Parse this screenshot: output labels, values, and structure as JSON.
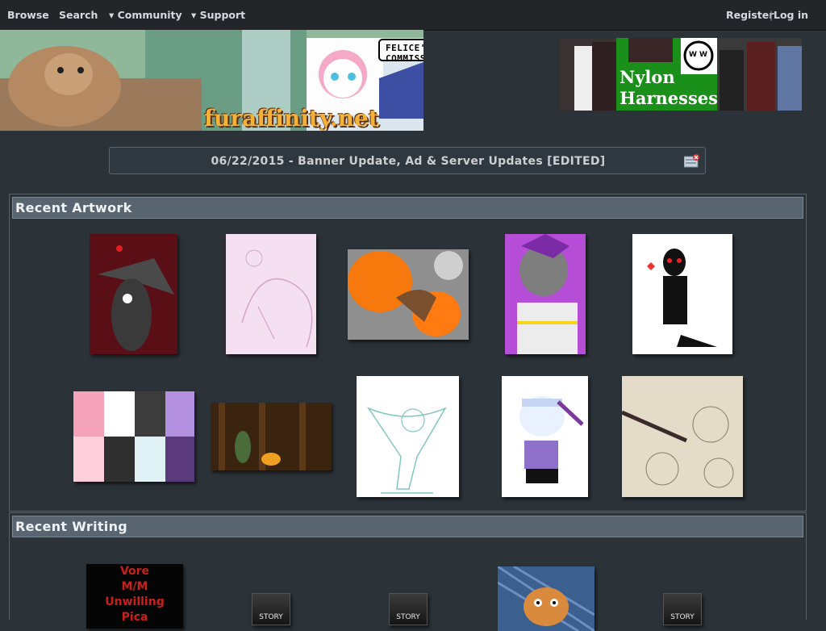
{
  "nav": {
    "browse": "Browse",
    "search": "Search",
    "community": "▾ Community",
    "support": "▾ Support",
    "register": "Register",
    "separator": "|",
    "login": "Log in"
  },
  "banner": {
    "site_name": "furaffinity.net",
    "speech_bubble": "FELICE'S COMMISSIONS!"
  },
  "ad": {
    "text_line1": "Nylon",
    "text_line2": "Harnesses",
    "logo_letters": "W W"
  },
  "announcement": {
    "text": "06/22/2015 - Banner Update, Ad & Server Updates [EDITED]",
    "icon": "close-ad-icon"
  },
  "recent_artwork": {
    "title": "Recent Artwork"
  },
  "recent_writing": {
    "title": "Recent Writing",
    "thumb1_lines": [
      "Vore",
      "M/M",
      "Unwilling",
      "Pica"
    ],
    "story_label": "STORY"
  },
  "colors": {
    "background": "#2b3339",
    "topbar": "#222629",
    "section_header": "#58646f"
  }
}
